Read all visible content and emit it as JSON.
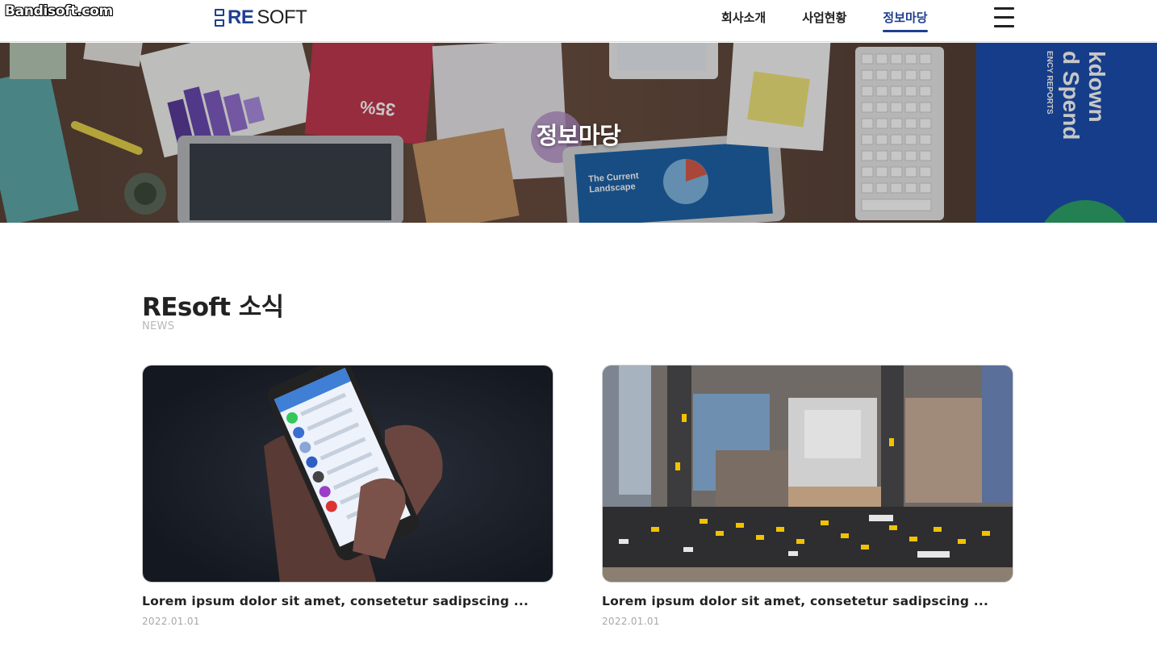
{
  "watermark": "Bandisoft.com",
  "header": {
    "logo_re": "RE",
    "logo_soft": "SOFT",
    "nav": [
      {
        "label": "회사소개",
        "active": false
      },
      {
        "label": "사업현황",
        "active": false
      },
      {
        "label": "정보마당",
        "active": true
      }
    ],
    "menu_icon": "hamburger-menu-icon"
  },
  "hero": {
    "title": "정보마당"
  },
  "section": {
    "title": "REsoft 소식",
    "subtitle": "NEWS"
  },
  "cards": [
    {
      "title": "Lorem ipsum dolor sit amet, consetetur sadipscing ...",
      "date": "2022.01.01",
      "image": "hand-holding-smartphone-photo"
    },
    {
      "title": "Lorem ipsum dolor sit amet, consetetur sadipscing ...",
      "date": "2022.01.01",
      "image": "city-aerial-street-photo"
    }
  ],
  "colors": {
    "brand": "#1f3f8f",
    "text": "#222222",
    "muted": "#a8a8a8"
  }
}
